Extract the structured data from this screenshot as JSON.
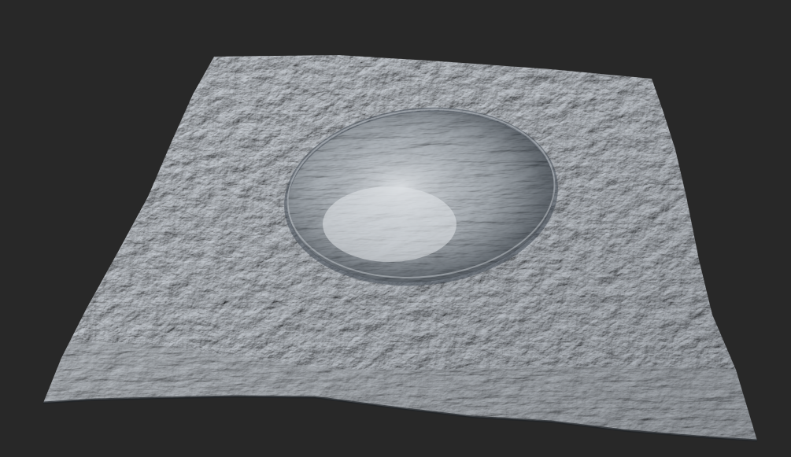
{
  "scene": {
    "subject": "terrain-heightmap-render",
    "colors": {
      "background": "#282828",
      "terrain_light": "#c9ced4",
      "terrain_mid": "#8c939b",
      "terrain_dark": "#3f4650",
      "crater_floor": "#d7dbdf",
      "crater_wall_shadow": "#30363f"
    }
  }
}
